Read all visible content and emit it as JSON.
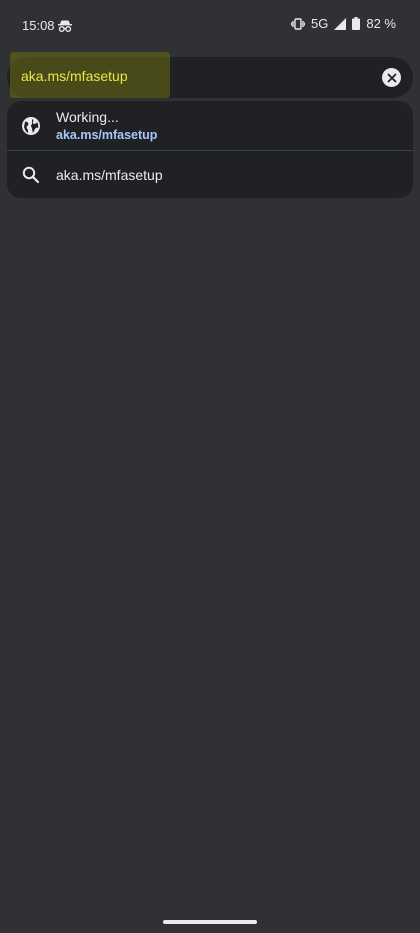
{
  "status_bar": {
    "time": "15:08",
    "network": "5G",
    "battery": "82 %"
  },
  "omnibox": {
    "url": "aka.ms/mfasetup"
  },
  "suggestions": [
    {
      "title": "Working...",
      "url": "aka.ms/mfasetup",
      "icon": "globe-icon"
    },
    {
      "query": "aka.ms/mfasetup",
      "icon": "search-icon"
    }
  ],
  "colors": {
    "background": "#303134",
    "surface": "#202124",
    "url_text": "#e8e84a",
    "link": "#a8c7fa"
  }
}
